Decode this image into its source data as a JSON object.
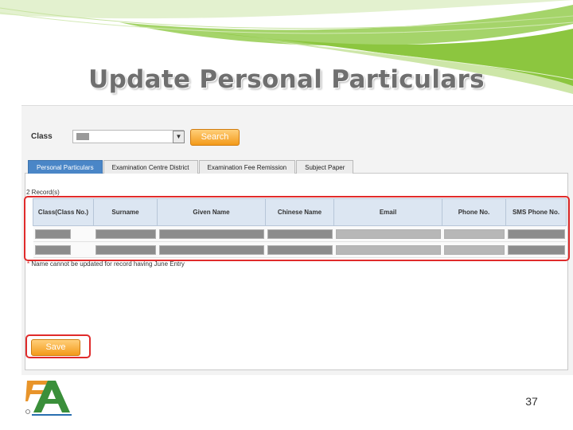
{
  "slide": {
    "title": "Update Personal Particulars",
    "page_number": "37"
  },
  "search_bar": {
    "class_label": "Class",
    "search_label": "Search"
  },
  "tabs": [
    {
      "label": "Personal Particulars",
      "active": true
    },
    {
      "label": "Examination Centre District",
      "active": false
    },
    {
      "label": "Examination Fee Remission",
      "active": false
    },
    {
      "label": "Subject Paper",
      "active": false
    }
  ],
  "records": {
    "count_label": "2  Record(s)"
  },
  "table": {
    "columns": [
      "Class(Class No.)",
      "Surname",
      "Given Name",
      "Chinese Name",
      "Email",
      "Phone No.",
      "SMS Phone No."
    ],
    "row_count": 2
  },
  "note": {
    "star": "*",
    "text": "Name cannot be updated for record having June Entry"
  },
  "buttons": {
    "save_label": "Save"
  },
  "colors": {
    "accent_orange": "#f39a1a",
    "tab_active": "#4a86c7",
    "highlight_red": "#e02b2b",
    "swoosh_green": "#8cc63f"
  }
}
